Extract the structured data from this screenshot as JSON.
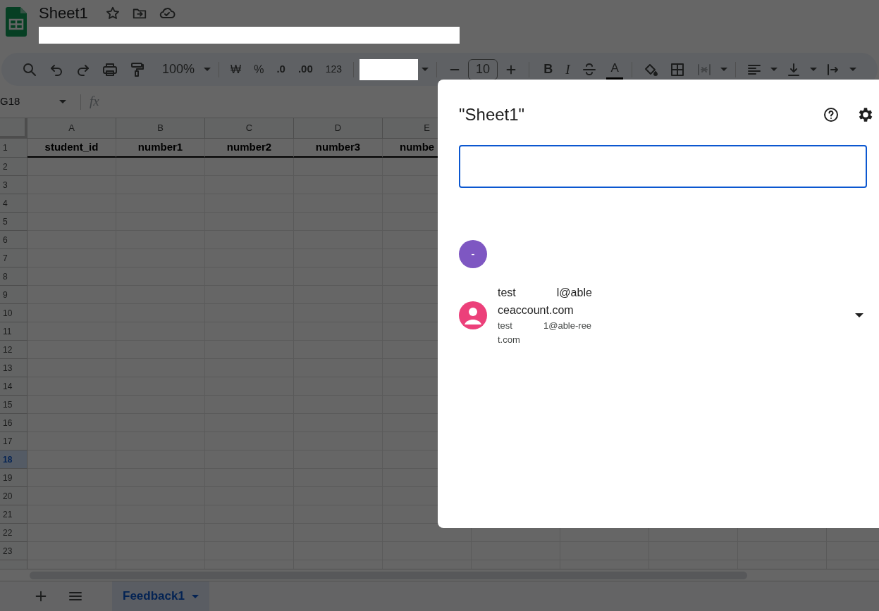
{
  "document": {
    "title": "Sheet1"
  },
  "toolbar": {
    "zoom": "100%",
    "currency": "₩",
    "percent": "%",
    "decrease_decimals": ".0",
    "increase_decimals": ".00",
    "number_format": "123",
    "font_size": "10",
    "bold": "B",
    "italic": "I",
    "text_color": "A",
    "merge_cells": {
      "disabled": true
    }
  },
  "formula_bar": {
    "cell_reference": "G18",
    "fx": "fx"
  },
  "grid": {
    "columns": [
      "A",
      "B",
      "C",
      "D",
      "E"
    ],
    "header_row": [
      "student_id",
      "number1",
      "number2",
      "number3",
      "numbe"
    ],
    "rows": [
      {
        "label": "1",
        "selected": false
      },
      {
        "label": "2",
        "selected": false
      },
      {
        "label": "3",
        "selected": false
      },
      {
        "label": "4",
        "selected": false
      },
      {
        "label": "5",
        "selected": false
      },
      {
        "label": "6",
        "selected": false
      },
      {
        "label": "7",
        "selected": false
      },
      {
        "label": "8",
        "selected": false
      },
      {
        "label": "9",
        "selected": false
      },
      {
        "label": "10",
        "selected": false
      },
      {
        "label": "11",
        "selected": false
      },
      {
        "label": "12",
        "selected": false
      },
      {
        "label": "13",
        "selected": false
      },
      {
        "label": "14",
        "selected": false
      },
      {
        "label": "15",
        "selected": false
      },
      {
        "label": "16",
        "selected": false
      },
      {
        "label": "17",
        "selected": false
      },
      {
        "label": "18",
        "selected": true
      },
      {
        "label": "19",
        "selected": false
      },
      {
        "label": "20",
        "selected": false
      },
      {
        "label": "21",
        "selected": false
      },
      {
        "label": "22",
        "selected": false
      },
      {
        "label": "23",
        "selected": false
      }
    ]
  },
  "sheet_tabs": [
    {
      "label": "Feedback1",
      "selected": true
    }
  ],
  "share_dialog": {
    "title": "\"Sheet1\"",
    "group_avatar": "-",
    "people": [
      {
        "name_parts": [
          "test",
          "l@able"
        ],
        "name_line2": "ceaccount.com",
        "email_parts": [
          "test",
          "1@able-ree"
        ],
        "email_line2": "t.com"
      }
    ]
  }
}
